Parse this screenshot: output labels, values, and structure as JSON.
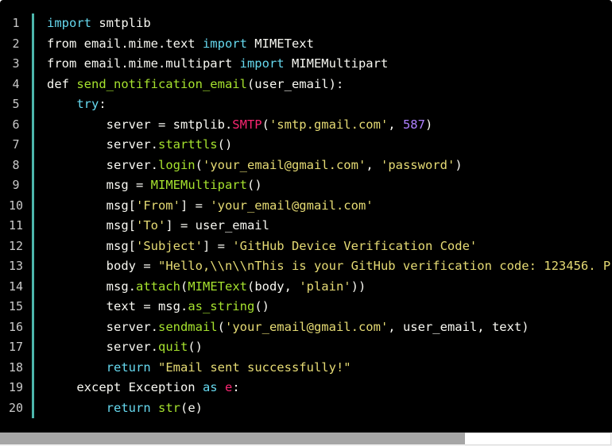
{
  "editor": {
    "line_numbers": [
      "1",
      "2",
      "3",
      "4",
      "5",
      "6",
      "7",
      "8",
      "9",
      "10",
      "11",
      "12",
      "13",
      "14",
      "15",
      "16",
      "17",
      "18",
      "19",
      "20"
    ],
    "lines": [
      [
        {
          "t": "import",
          "c": "kw"
        },
        {
          "t": " smtplib",
          "c": "pl"
        }
      ],
      [
        {
          "t": "from email.mime.text ",
          "c": "pl"
        },
        {
          "t": "import",
          "c": "kw"
        },
        {
          "t": " MIMEText",
          "c": "pl"
        }
      ],
      [
        {
          "t": "from email.mime.multipart ",
          "c": "pl"
        },
        {
          "t": "import",
          "c": "kw"
        },
        {
          "t": " MIMEMultipart",
          "c": "pl"
        }
      ],
      [
        {
          "t": "def ",
          "c": "pl"
        },
        {
          "t": "send_notification_email",
          "c": "fn"
        },
        {
          "t": "(user_email):",
          "c": "pl"
        }
      ],
      [
        {
          "t": "    ",
          "c": "pl"
        },
        {
          "t": "try",
          "c": "kw"
        },
        {
          "t": ":",
          "c": "pl"
        }
      ],
      [
        {
          "t": "        server = smtplib.",
          "c": "pl"
        },
        {
          "t": "SMTP",
          "c": "cls"
        },
        {
          "t": "(",
          "c": "pl"
        },
        {
          "t": "'smtp.gmail.com'",
          "c": "str"
        },
        {
          "t": ", ",
          "c": "pl"
        },
        {
          "t": "587",
          "c": "num"
        },
        {
          "t": ")",
          "c": "pl"
        }
      ],
      [
        {
          "t": "        server.",
          "c": "pl"
        },
        {
          "t": "starttls",
          "c": "fn"
        },
        {
          "t": "()",
          "c": "pl"
        }
      ],
      [
        {
          "t": "        server.",
          "c": "pl"
        },
        {
          "t": "login",
          "c": "fn"
        },
        {
          "t": "(",
          "c": "pl"
        },
        {
          "t": "'your_email@gmail.com'",
          "c": "str"
        },
        {
          "t": ", ",
          "c": "pl"
        },
        {
          "t": "'password'",
          "c": "str"
        },
        {
          "t": ")",
          "c": "pl"
        }
      ],
      [
        {
          "t": "        msg = ",
          "c": "pl"
        },
        {
          "t": "MIMEMultipart",
          "c": "fn"
        },
        {
          "t": "()",
          "c": "pl"
        }
      ],
      [
        {
          "t": "        msg[",
          "c": "pl"
        },
        {
          "t": "'From'",
          "c": "str"
        },
        {
          "t": "] = ",
          "c": "pl"
        },
        {
          "t": "'your_email@gmail.com'",
          "c": "str"
        }
      ],
      [
        {
          "t": "        msg[",
          "c": "pl"
        },
        {
          "t": "'To'",
          "c": "str"
        },
        {
          "t": "] = user_email",
          "c": "pl"
        }
      ],
      [
        {
          "t": "        msg[",
          "c": "pl"
        },
        {
          "t": "'Subject'",
          "c": "str"
        },
        {
          "t": "] = ",
          "c": "pl"
        },
        {
          "t": "'GitHub Device Verification Code'",
          "c": "str"
        }
      ],
      [
        {
          "t": "        body = ",
          "c": "pl"
        },
        {
          "t": "\"Hello,\\\\n\\\\nThis is your GitHub verification code: 123456. P",
          "c": "str"
        }
      ],
      [
        {
          "t": "        msg.",
          "c": "pl"
        },
        {
          "t": "attach",
          "c": "fn"
        },
        {
          "t": "(",
          "c": "pl"
        },
        {
          "t": "MIMEText",
          "c": "fn"
        },
        {
          "t": "(body, ",
          "c": "pl"
        },
        {
          "t": "'plain'",
          "c": "str"
        },
        {
          "t": "))",
          "c": "pl"
        }
      ],
      [
        {
          "t": "        text = msg.",
          "c": "pl"
        },
        {
          "t": "as_string",
          "c": "fn"
        },
        {
          "t": "()",
          "c": "pl"
        }
      ],
      [
        {
          "t": "        server.",
          "c": "pl"
        },
        {
          "t": "sendmail",
          "c": "fn"
        },
        {
          "t": "(",
          "c": "pl"
        },
        {
          "t": "'your_email@gmail.com'",
          "c": "str"
        },
        {
          "t": ", user_email, text)",
          "c": "pl"
        }
      ],
      [
        {
          "t": "        server.",
          "c": "pl"
        },
        {
          "t": "quit",
          "c": "fn"
        },
        {
          "t": "()",
          "c": "pl"
        }
      ],
      [
        {
          "t": "        ",
          "c": "pl"
        },
        {
          "t": "return",
          "c": "kw"
        },
        {
          "t": " ",
          "c": "pl"
        },
        {
          "t": "\"Email sent successfully!\"",
          "c": "str"
        }
      ],
      [
        {
          "t": "    except Exception ",
          "c": "pl"
        },
        {
          "t": "as",
          "c": "kw"
        },
        {
          "t": " ",
          "c": "pl"
        },
        {
          "t": "e",
          "c": "cls"
        },
        {
          "t": ":",
          "c": "pl"
        }
      ],
      [
        {
          "t": "        ",
          "c": "pl"
        },
        {
          "t": "return",
          "c": "kw"
        },
        {
          "t": " ",
          "c": "pl"
        },
        {
          "t": "str",
          "c": "fn"
        },
        {
          "t": "(e)",
          "c": "pl"
        }
      ]
    ]
  },
  "scrollbar": {
    "horizontal_position_fraction": 0.0,
    "visible_fraction": 0.76
  },
  "colors": {
    "background": "#000000",
    "gutter_border": "#4db6ac",
    "keyword": "#66d9ef",
    "function": "#a6e22e",
    "string": "#e6db74",
    "number": "#ae81ff"
  }
}
